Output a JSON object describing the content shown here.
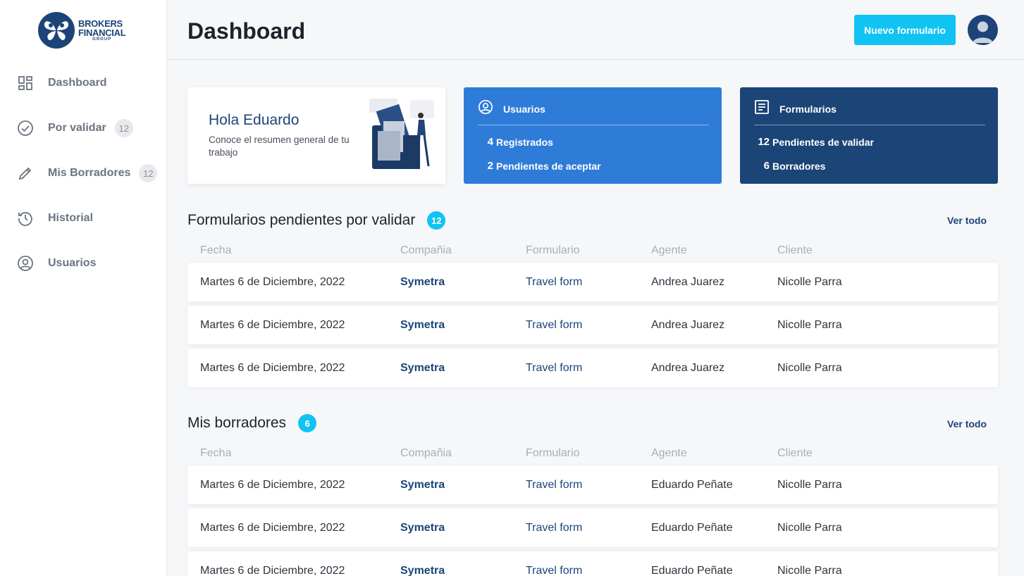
{
  "brand": {
    "line1": "BROKERS",
    "line2": "FINANCIAL",
    "line3": "GROUP",
    "color": "#1d4478"
  },
  "sidebar": {
    "items": [
      {
        "label": "Dashboard",
        "icon": "dashboard-icon",
        "badge": ""
      },
      {
        "label": "Por validar",
        "icon": "check-circle-icon",
        "badge": "12"
      },
      {
        "label": "Mis Borradores",
        "icon": "pencil-icon",
        "badge": "12"
      },
      {
        "label": "Historial",
        "icon": "history-icon",
        "badge": ""
      },
      {
        "label": "Usuarios",
        "icon": "user-circle-icon",
        "badge": ""
      }
    ]
  },
  "header": {
    "title": "Dashboard",
    "new_form_label": "Nuevo formulario",
    "accent": "#11c3f3"
  },
  "welcome": {
    "title": "Hola Eduardo",
    "subtitle": "Conoce el resumen general  de tu trabajo"
  },
  "users_card": {
    "title": "Usuarios",
    "rows": [
      {
        "num": "4",
        "label": "Registrados"
      },
      {
        "num": "2",
        "label": "Pendientes de aceptar"
      }
    ],
    "color": "#2f7cd8"
  },
  "forms_card": {
    "title": "Formularios",
    "rows": [
      {
        "num": "12",
        "label": "Pendientes de validar"
      },
      {
        "num": "6",
        "label": "Borradores"
      }
    ],
    "color": "#1b4577"
  },
  "pending": {
    "title": "Formularios pendientes por validar",
    "count": "12",
    "see_all": "Ver todo",
    "columns": [
      "Fecha",
      "Compañia",
      "Formulario",
      "Agente",
      "Cliente"
    ],
    "rows": [
      [
        "Martes 6 de Diciembre, 2022",
        "Symetra",
        "Travel form",
        "Andrea Juarez",
        "Nicolle Parra"
      ],
      [
        "Martes 6 de Diciembre, 2022",
        "Symetra",
        "Travel form",
        "Andrea Juarez",
        "Nicolle Parra"
      ],
      [
        "Martes 6 de Diciembre, 2022",
        "Symetra",
        "Travel form",
        "Andrea Juarez",
        "Nicolle Parra"
      ]
    ]
  },
  "drafts": {
    "title": "Mis borradores",
    "count": "6",
    "see_all": "Ver todo",
    "columns": [
      "Fecha",
      "Compañia",
      "Formulario",
      "Agente",
      "Cliente"
    ],
    "rows": [
      [
        "Martes 6 de Diciembre, 2022",
        "Symetra",
        "Travel form",
        "Eduardo Peñate",
        "Nicolle Parra"
      ],
      [
        "Martes 6 de Diciembre, 2022",
        "Symetra",
        "Travel form",
        "Eduardo Peñate",
        "Nicolle Parra"
      ],
      [
        "Martes 6 de Diciembre, 2022",
        "Symetra",
        "Travel form",
        "Eduardo Peñate",
        "Nicolle Parra"
      ]
    ]
  }
}
